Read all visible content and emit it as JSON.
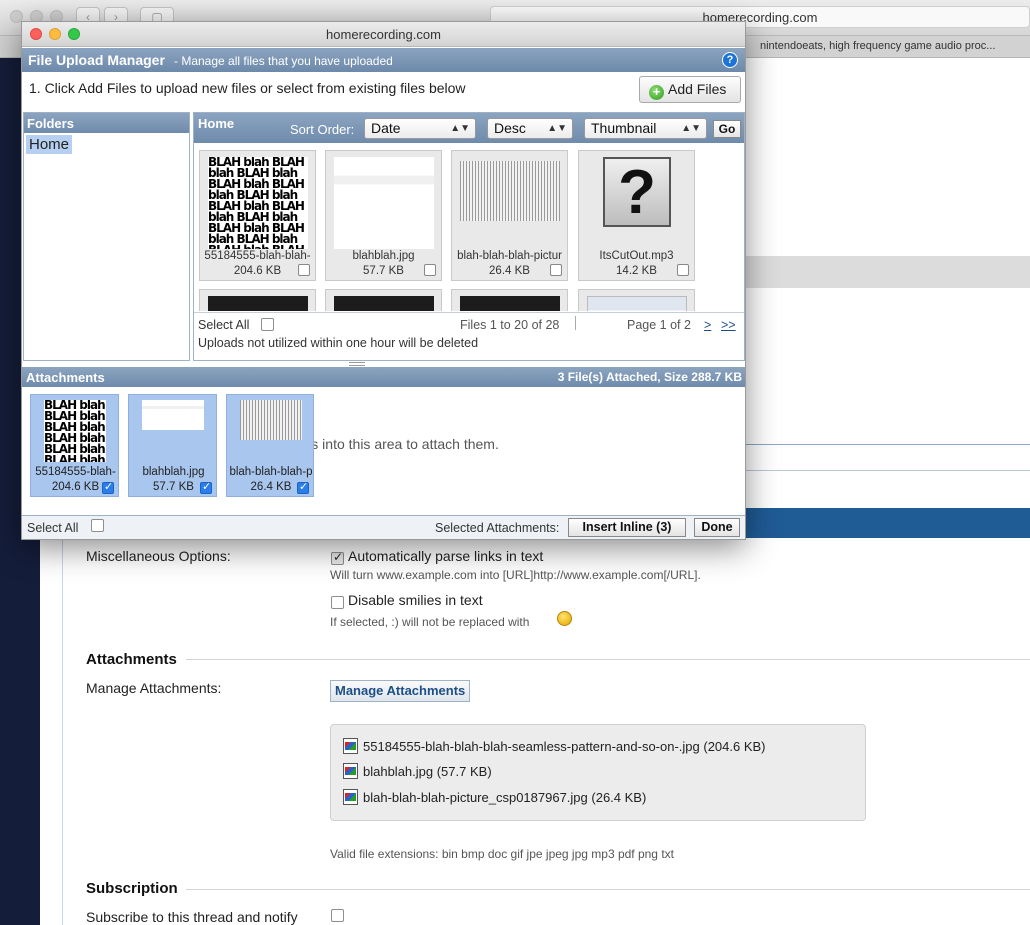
{
  "browser": {
    "url": "homerecording.com",
    "tab_title": "nintendoeats, high frequency game audio proc..."
  },
  "popup": {
    "window_title": "homerecording.com",
    "header_title": "File Upload Manager",
    "header_subtitle": "- Manage all files that you have uploaded",
    "help_icon": "?",
    "instruction": "1. Click Add Files to upload new files or select from existing files below",
    "add_files_label": "Add Files",
    "folders": {
      "header": "Folders",
      "items": [
        "Home"
      ]
    },
    "files": {
      "header": "Home",
      "sort_label": "Sort Order:",
      "sort_field": "Date",
      "sort_direction": "Desc",
      "view_mode": "Thumbnail",
      "go_label": "Go",
      "tiles": [
        {
          "name": "55184555-blah-blah-",
          "size": "204.6 KB",
          "thumb": "blah-text"
        },
        {
          "name": "blahblah.jpg",
          "size": "57.7 KB",
          "thumb": "blah-strip"
        },
        {
          "name": "blah-blah-blah-pictur",
          "size": "26.4 KB",
          "thumb": "blah-perspective"
        },
        {
          "name": "ItsCutOut.mp3",
          "size": "14.2 KB",
          "thumb": "question-mark-icon"
        }
      ],
      "select_all_label": "Select All",
      "count_text": "Files 1 to 20 of 28",
      "page_text": "Page 1 of 2",
      "next_label": ">",
      "last_label": ">>",
      "uploads_note": "Uploads not utilized within one hour will be deleted"
    },
    "attachments": {
      "header": "Attachments",
      "stats": "3 File(s) Attached, Size 288.7 KB",
      "drop_hint": "g      ploaded files into this area to attach them.",
      "items": [
        {
          "name": "55184555-blah-",
          "size": "204.6 KB"
        },
        {
          "name": "blahblah.jpg",
          "size": "57.7 KB"
        },
        {
          "name": "blah-blah-blah-p",
          "size": "26.4 KB"
        }
      ]
    },
    "footer": {
      "select_all_label": "Select All",
      "selected_label": "Selected Attachments:",
      "insert_label": "Insert Inline (3)",
      "done_label": "Done"
    }
  },
  "page": {
    "misc_label": "Miscellaneous Options:",
    "parse_links_label": "Automatically parse links in text",
    "parse_links_hint": "Will turn www.example.com into [URL]http://www.example.com[/URL].",
    "disable_smilies_label": "Disable smilies in text",
    "disable_smilies_hint": "If selected, :) will not be replaced with",
    "attachments_heading": "Attachments",
    "manage_label": "Manage Attachments:",
    "manage_button": "Manage Attachments",
    "attached_files": [
      "55184555-blah-blah-blah-seamless-pattern-and-so-on-.jpg (204.6 KB)",
      "blahblah.jpg (57.7 KB)",
      "blah-blah-blah-picture_csp0187967.jpg (26.4 KB)"
    ],
    "valid_extensions": "Valid file extensions: bin bmp doc gif jpe jpeg jpg mp3 pdf png txt",
    "subscription_heading": "Subscription",
    "subscribe_label": "Subscribe to this thread and notify"
  }
}
